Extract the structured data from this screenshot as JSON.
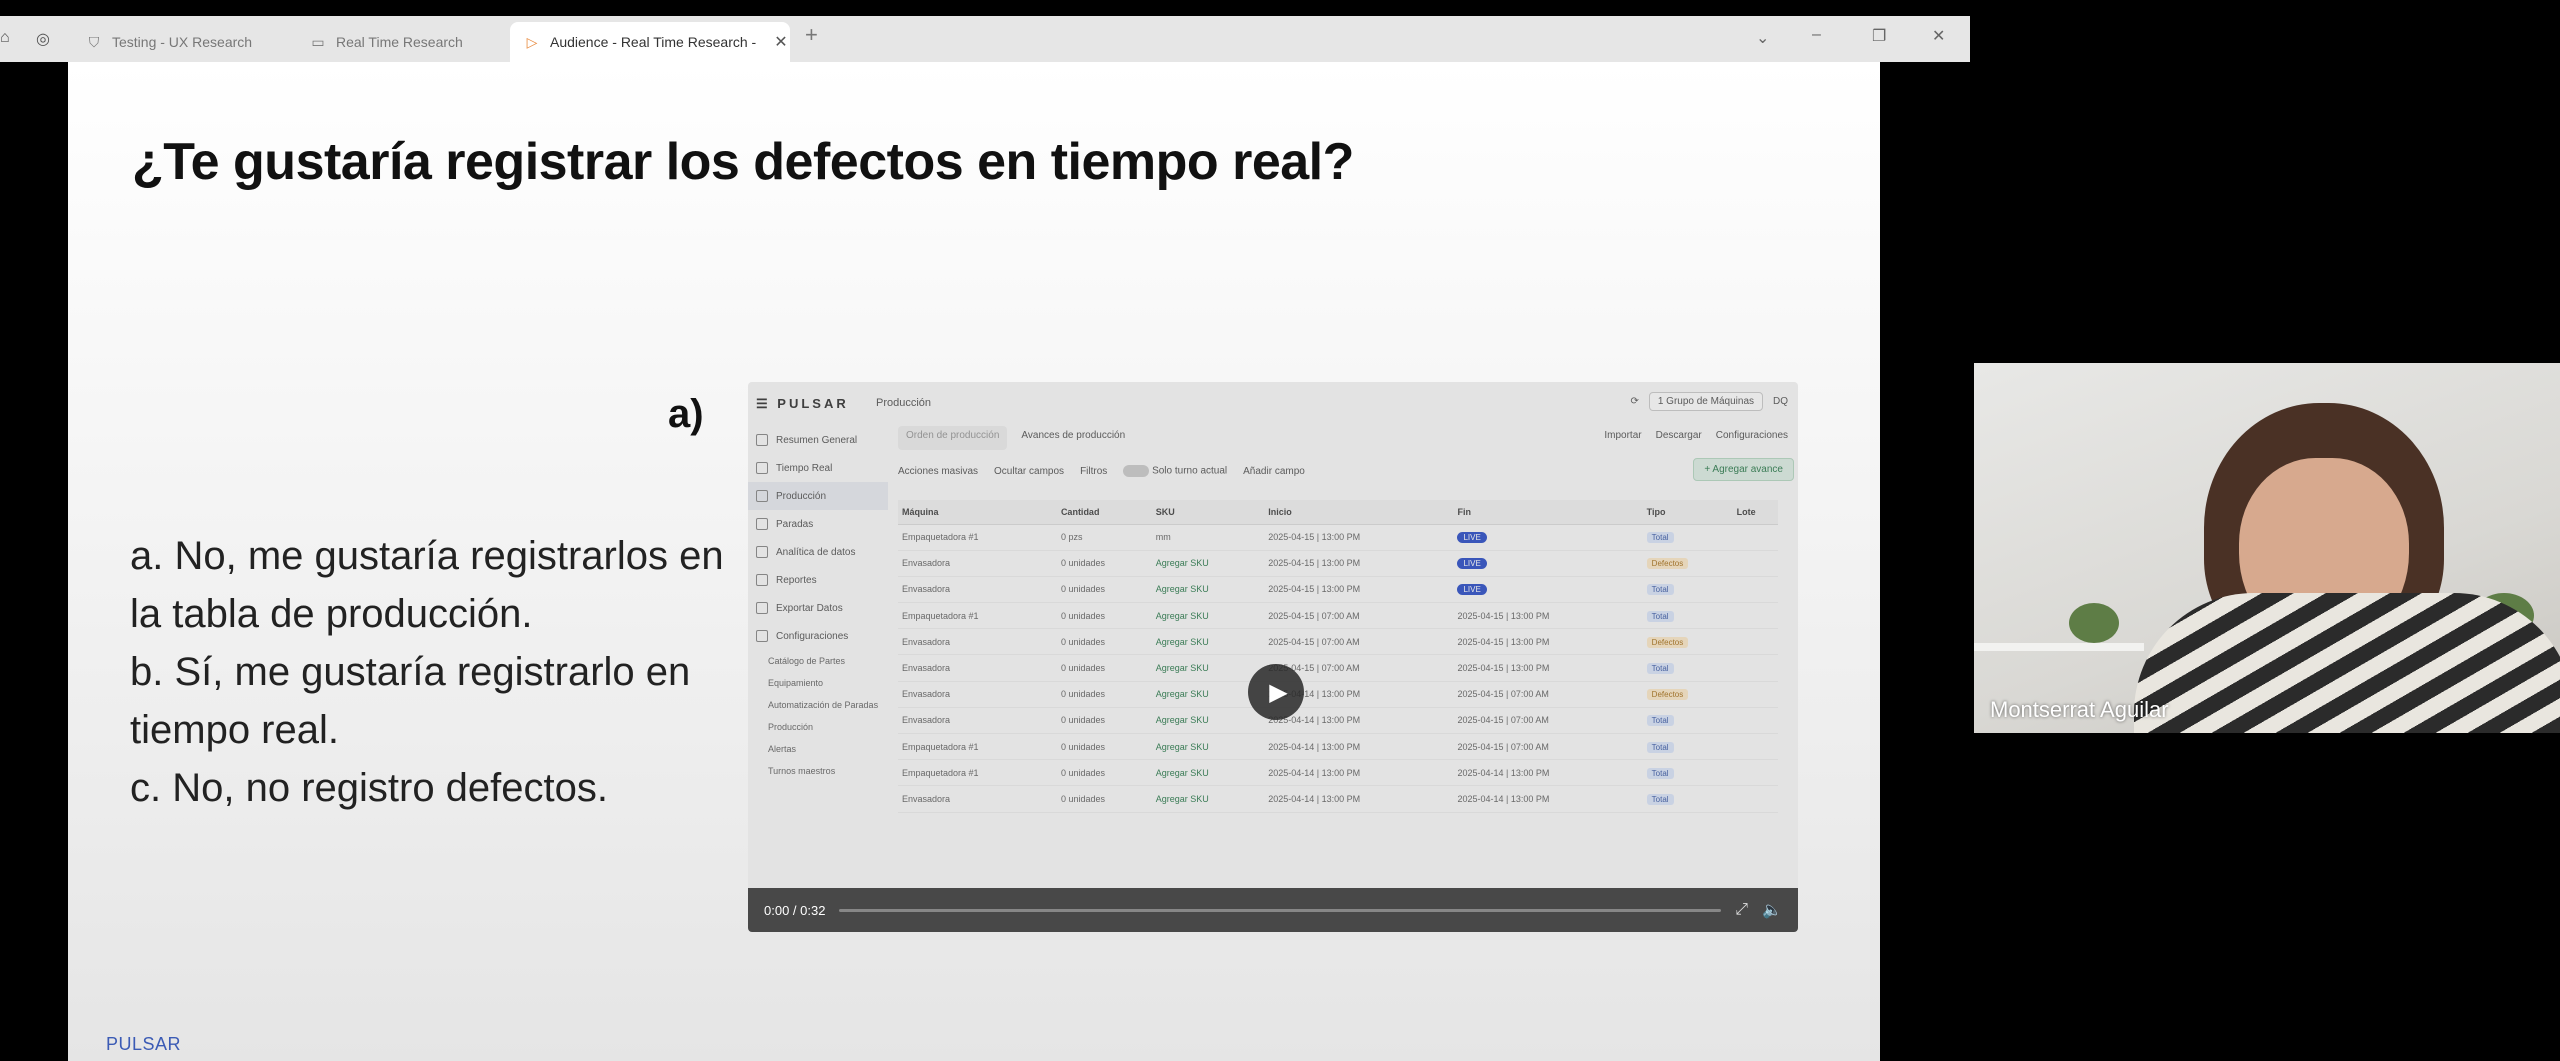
{
  "browser": {
    "tabs": [
      {
        "label": "Testing - UX Research",
        "icon": "shield-icon"
      },
      {
        "label": "Real Time Research",
        "icon": "chat-icon"
      },
      {
        "label": "Audience - Real Time Research -",
        "icon": "play-icon"
      }
    ],
    "new_tab": "+",
    "close_tab": "✕"
  },
  "slide": {
    "question": "¿Te gustaría registrar los defectos en tiempo real?",
    "option_label": "a)",
    "options": [
      "a. No, me gustaría registrarlos en",
      "la tabla de producción.",
      "b. Sí, me gustaría registrarlo en",
      "tiempo real.",
      "c. No, no registro defectos."
    ],
    "footer": "PULSAR"
  },
  "video": {
    "time": "0:00 / 0:32",
    "app": {
      "brand": "PULSAR",
      "crumb": "Producción",
      "machine_group": "1 Grupo de Máquinas",
      "user": "DQ",
      "sidebar": [
        "Resumen General",
        "Tiempo Real",
        "Producción",
        "Paradas",
        "Analítica de datos",
        "Reportes",
        "Exportar Datos",
        "Configuraciones"
      ],
      "subitems": [
        "Catálogo de Partes",
        "Equipamiento",
        "Automatización de Paradas",
        "Producción",
        "Alertas",
        "Turnos maestros"
      ],
      "subtabs": [
        "Orden de producción",
        "Avances de producción"
      ],
      "right_actions": [
        "Importar",
        "Descargar",
        "Configuraciones"
      ],
      "toolbar": [
        "Acciones masivas",
        "Ocultar campos",
        "Filtros",
        "Solo turno actual",
        "Añadir campo"
      ],
      "add_button": "+ Agregar avance",
      "columns": [
        "Máquina",
        "Cantidad",
        "SKU",
        "Inicio",
        "Fin",
        "Tipo",
        "Lote"
      ],
      "rows": [
        [
          "Empaquetadora #1",
          "0 pzs",
          "mm",
          "2025-04-15 | 13:00 PM",
          "LIVE",
          "Total"
        ],
        [
          "Envasadora",
          "0 unidades",
          "Agregar SKU",
          "2025-04-15 | 13:00 PM",
          "LIVE",
          "Defectos"
        ],
        [
          "Envasadora",
          "0 unidades",
          "Agregar SKU",
          "2025-04-15 | 13:00 PM",
          "LIVE",
          "Total"
        ],
        [
          "Empaquetadora #1",
          "0 unidades",
          "Agregar SKU",
          "2025-04-15 | 07:00 AM",
          "2025-04-15 | 13:00 PM",
          "Total"
        ],
        [
          "Envasadora",
          "0 unidades",
          "Agregar SKU",
          "2025-04-15 | 07:00 AM",
          "2025-04-15 | 13:00 PM",
          "Defectos"
        ],
        [
          "Envasadora",
          "0 unidades",
          "Agregar SKU",
          "2025-04-15 | 07:00 AM",
          "2025-04-15 | 13:00 PM",
          "Total"
        ],
        [
          "Envasadora",
          "0 unidades",
          "Agregar SKU",
          "2025-04-14 | 13:00 PM",
          "2025-04-15 | 07:00 AM",
          "Defectos"
        ],
        [
          "Envasadora",
          "0 unidades",
          "Agregar SKU",
          "2025-04-14 | 13:00 PM",
          "2025-04-15 | 07:00 AM",
          "Total"
        ],
        [
          "Empaquetadora #1",
          "0 unidades",
          "Agregar SKU",
          "2025-04-14 | 13:00 PM",
          "2025-04-15 | 07:00 AM",
          "Total"
        ],
        [
          "Empaquetadora #1",
          "0 unidades",
          "Agregar SKU",
          "2025-04-14 | 13:00 PM",
          "2025-04-14 | 13:00 PM",
          "Total"
        ],
        [
          "Envasadora",
          "0 unidades",
          "Agregar SKU",
          "2025-04-14 | 13:00 PM",
          "2025-04-14 | 13:00 PM",
          "Total"
        ]
      ]
    }
  },
  "webcam": {
    "name": "Montserrat Aguilar"
  }
}
